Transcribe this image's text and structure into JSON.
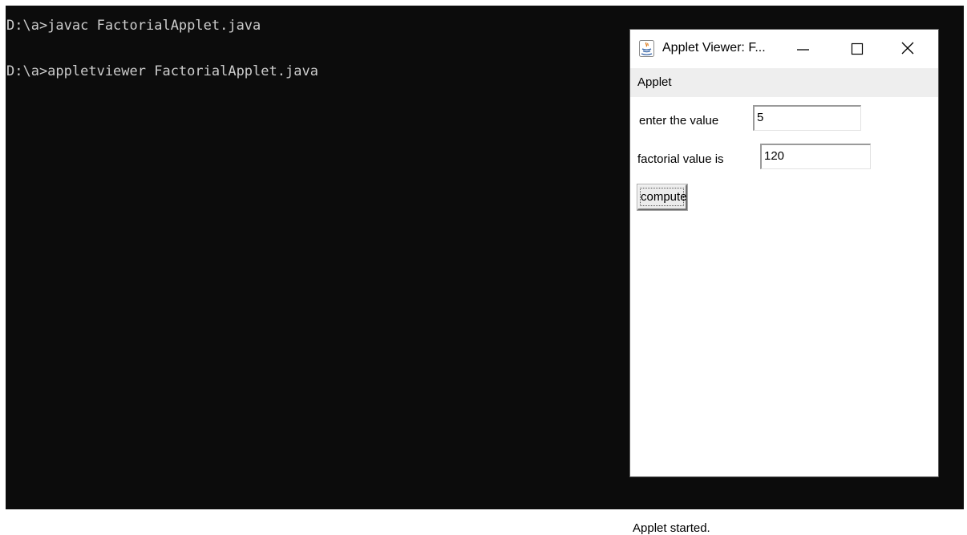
{
  "console": {
    "lines": [
      "D:\\a>javac FactorialApplet.java",
      "D:\\a>appletviewer FactorialApplet.java"
    ]
  },
  "applet_window": {
    "title": "Applet Viewer: F...",
    "menu": {
      "applet_label": "Applet"
    },
    "form": {
      "enter_label": "enter the value",
      "enter_value": "5",
      "factorial_label": "factorial value is",
      "factorial_value": "120",
      "compute_label": "compute"
    },
    "status": "Applet started."
  },
  "colors": {
    "console_background": "#0c0c0c",
    "console_text": "#cccccc",
    "menu_bar": "#eeeeee",
    "window_background": "#ffffff"
  },
  "icons": {
    "app_icon": "java-icon",
    "minimize": "minimize-icon",
    "maximize": "maximize-icon",
    "close": "close-icon"
  }
}
